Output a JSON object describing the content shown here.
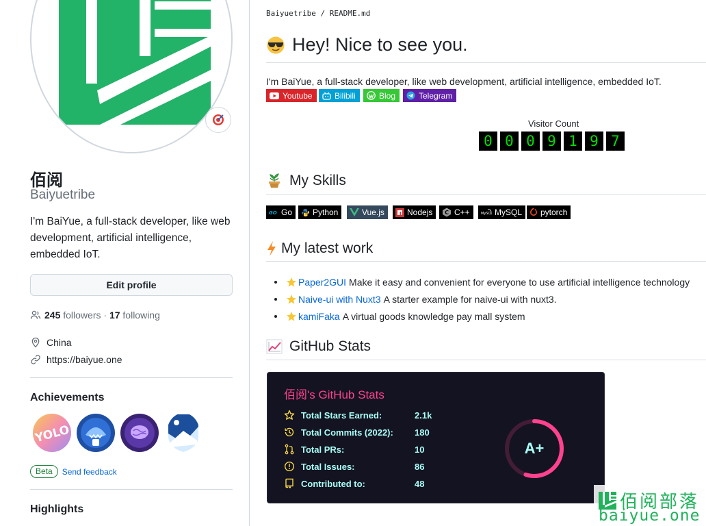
{
  "profile": {
    "name": "佰阅",
    "login": "Baiyuetribe",
    "bio": "I'm BaiYue, a full-stack developer, like web development, artificial intelligence, embedded IoT.",
    "edit_label": "Edit profile",
    "followers_count": "245",
    "followers_label": " followers · ",
    "following_count": "17",
    "following_label": " following",
    "location": "China",
    "website": "https://baiyue.one"
  },
  "achievements": {
    "title": "Achievements",
    "badges": [
      "yolo-badge",
      "pull-shark-badge",
      "galaxy-brain-badge",
      "arctic-code-vault-badge"
    ],
    "beta_label": "Beta",
    "feedback_label": "Send feedback"
  },
  "highlights": {
    "title": "Highlights"
  },
  "readme": {
    "breadcrumb_owner": "Baiyuetribe",
    "breadcrumb_sep": " / ",
    "breadcrumb_file": "README.md",
    "title": "Hey! Nice to see you.",
    "intro": "I'm BaiYue, a full-stack developer, like web development, artificial intelligence, embedded IoT.",
    "social": [
      {
        "label": "Youtube",
        "color": "#d9252a"
      },
      {
        "label": "Bilibili",
        "color": "#00a1d6"
      },
      {
        "label": "Blog",
        "color": "#36c836"
      },
      {
        "label": "Telegram",
        "color": "#5f1fa6"
      }
    ],
    "visitor_label": "Visitor Count",
    "visitor_digits": [
      "0",
      "0",
      "0",
      "9",
      "1",
      "9",
      "7"
    ],
    "skills_title": "My Skills",
    "skills": [
      "Go",
      "Python",
      "Vue.js",
      "Nodejs",
      "C++",
      "MySQL",
      "pytorch"
    ],
    "work_title": "My latest work",
    "work": [
      {
        "link": "Paper2GUI",
        "desc": "Make it easy and convenient for everyone to use artificial intelligence technology"
      },
      {
        "link": "Naive-ui with Nuxt3",
        "desc": "A starter example for naive-ui with nuxt3."
      },
      {
        "link": "kamiFaka",
        "desc": "A virtual goods knowledge pay mall system"
      }
    ],
    "stats_title_section": "GitHub Stats"
  },
  "stats_card": {
    "title": "佰阅's GitHub Stats",
    "rows": [
      {
        "label": "Total Stars Earned:",
        "value": "2.1k"
      },
      {
        "label": "Total Commits (2022):",
        "value": "180"
      },
      {
        "label": "Total PRs:",
        "value": "10"
      },
      {
        "label": "Total Issues:",
        "value": "86"
      },
      {
        "label": "Contributed to:",
        "value": "48"
      }
    ],
    "rank": "A+",
    "rank_progress": 0.55,
    "colors": {
      "bg": "#141321",
      "title": "#fe428e",
      "text": "#a9fef7",
      "icon": "#f8d847",
      "ring": "#fe428e"
    }
  },
  "watermark": {
    "text": "佰阅部落",
    "url": "baiyue.one",
    "color": "#1fb35a"
  }
}
